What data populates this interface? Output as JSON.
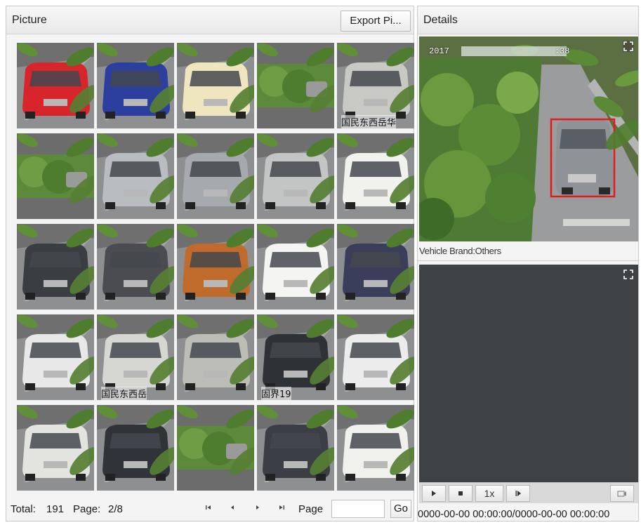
{
  "picture_panel": {
    "title": "Picture",
    "export_label": "Export Pi..."
  },
  "thumbnails": [
    {
      "name": "thumb-r1-c1",
      "car_color": "#d8242b",
      "kind": "car"
    },
    {
      "name": "thumb-r1-c2",
      "car_color": "#2c3f9e",
      "kind": "car"
    },
    {
      "name": "thumb-r1-c3",
      "car_color": "#efe6c0",
      "kind": "car"
    },
    {
      "name": "thumb-r1-c4",
      "car_color": "#7a7a7a",
      "kind": "hedge"
    },
    {
      "name": "thumb-r1-c5",
      "car_color": "#c8c8c4",
      "kind": "car",
      "overlay_text": "国民东西岳华"
    },
    {
      "name": "thumb-r2-c1",
      "car_color": "#7a7a7a",
      "kind": "hedge"
    },
    {
      "name": "thumb-r2-c2",
      "car_color": "#b9bcc0",
      "kind": "car"
    },
    {
      "name": "thumb-r2-c3",
      "car_color": "#a6a9ad",
      "kind": "car",
      "selected": true
    },
    {
      "name": "thumb-r2-c4",
      "car_color": "#c3c5c5",
      "kind": "car"
    },
    {
      "name": "thumb-r2-c5",
      "car_color": "#f1f1ee",
      "kind": "car"
    },
    {
      "name": "thumb-r3-c1",
      "car_color": "#3a3d42",
      "kind": "car"
    },
    {
      "name": "thumb-r3-c2",
      "car_color": "#4a4c52",
      "kind": "car"
    },
    {
      "name": "thumb-r3-c3",
      "car_color": "#c06a2c",
      "kind": "car"
    },
    {
      "name": "thumb-r3-c4",
      "car_color": "#f4f4f2",
      "kind": "car"
    },
    {
      "name": "thumb-r3-c5",
      "car_color": "#3a3e5a",
      "kind": "car"
    },
    {
      "name": "thumb-r4-c1",
      "car_color": "#e8e8e8",
      "kind": "car"
    },
    {
      "name": "thumb-r4-c2",
      "car_color": "#d6d6d2",
      "kind": "car",
      "overlay_text": "国民东西岳"
    },
    {
      "name": "thumb-r4-c3",
      "car_color": "#bdbdb8",
      "kind": "car"
    },
    {
      "name": "thumb-r4-c4",
      "car_color": "#2e3135",
      "kind": "car",
      "overlay_text": "固界19"
    },
    {
      "name": "thumb-r4-c5",
      "car_color": "#ececec",
      "kind": "car"
    },
    {
      "name": "thumb-r5-c1",
      "car_color": "#e3e3e0",
      "kind": "car"
    },
    {
      "name": "thumb-r5-c2",
      "car_color": "#303338",
      "kind": "car"
    },
    {
      "name": "thumb-r5-c3",
      "car_color": "#7a7a7a",
      "kind": "hedge"
    },
    {
      "name": "thumb-r5-c4",
      "car_color": "#3b3e44",
      "kind": "car"
    },
    {
      "name": "thumb-r5-c5",
      "car_color": "#f0f0ed",
      "kind": "car"
    }
  ],
  "pager": {
    "total_label": "Total:",
    "total_value": "191",
    "page_label": "Page:",
    "page_value": "2/8",
    "first_icon": "first-page-icon",
    "prev_icon": "prev-page-icon",
    "next_icon": "next-page-icon",
    "last_icon": "last-page-icon",
    "goto_label": "Page",
    "page_input_value": "",
    "go_label": "Go"
  },
  "details": {
    "title": "Details",
    "timestamp_prefix": "2017",
    "timestamp_suffix": ":38",
    "brand_text": "Vehicle Brand:Others",
    "video": {
      "play_icon": "play-icon",
      "stop_icon": "stop-icon",
      "speed_label": "1x",
      "frame_icon": "step-frame-icon",
      "download_icon": "download-icon"
    },
    "time_range": "0000-00-00 00:00:00/0000-00-00 00:00:00"
  },
  "colors": {
    "header_bg": "#ececec",
    "video_bg": "#3f4244",
    "selection": "#f2e30e",
    "detection_box": "#e21b1b"
  }
}
